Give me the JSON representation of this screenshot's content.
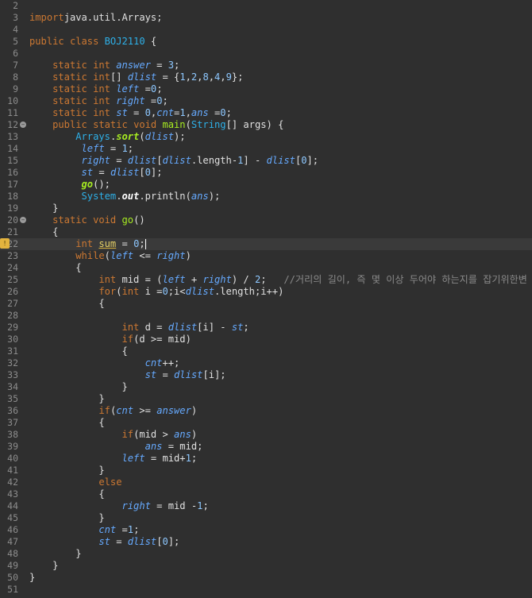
{
  "editor": {
    "language": "java",
    "class_name": "BOJ2110",
    "cursor_line": 22,
    "colors": {
      "background": "#2f2f2f",
      "current_line": "#3a3a3a",
      "keyword": "#cc7832",
      "field": "#66aaff",
      "method": "#a7ec21",
      "class": "#2eb0e8",
      "comment": "#8a8a8a"
    },
    "line_numbers": [
      "2",
      "3",
      "4",
      "5",
      "6",
      "7",
      "8",
      "9",
      "10",
      "11",
      "12",
      "13",
      "14",
      "15",
      "16",
      "17",
      "18",
      "19",
      "20",
      "21",
      "22",
      "23",
      "24",
      "25",
      "26",
      "27",
      "28",
      "29",
      "30",
      "31",
      "32",
      "33",
      "34",
      "35",
      "36",
      "37",
      "38",
      "39",
      "40",
      "41",
      "42",
      "43",
      "44",
      "45",
      "46",
      "47",
      "48",
      "49",
      "50",
      "51"
    ],
    "fold_markers": [
      "12",
      "20"
    ],
    "quick_fix_line": "22",
    "quick_fix_icon": "lightbulb-warning-icon",
    "lines": [
      [],
      [
        [
          "kw",
          "import"
        ],
        [
          "",
          "java.util.Arrays;"
        ]
      ],
      [],
      [
        [
          "kw",
          "public"
        ],
        [
          "",
          " "
        ],
        [
          "kw",
          "class"
        ],
        [
          "",
          " "
        ],
        [
          "cls",
          "BOJ2110"
        ],
        [
          "",
          " {"
        ]
      ],
      [],
      [
        [
          "",
          "    "
        ],
        [
          "kw",
          "static"
        ],
        [
          "",
          " "
        ],
        [
          "kw",
          "int"
        ],
        [
          "",
          " "
        ],
        [
          "fld",
          "answer"
        ],
        [
          "",
          " = "
        ],
        [
          "num",
          "3"
        ],
        [
          "",
          ";"
        ]
      ],
      [
        [
          "",
          "    "
        ],
        [
          "kw",
          "static"
        ],
        [
          "",
          " "
        ],
        [
          "kw",
          "int"
        ],
        [
          "",
          "[] "
        ],
        [
          "fld",
          "dlist"
        ],
        [
          "",
          " = {"
        ],
        [
          "num",
          "1"
        ],
        [
          "",
          ","
        ],
        [
          "num",
          "2"
        ],
        [
          "",
          ","
        ],
        [
          "num",
          "8"
        ],
        [
          "",
          ","
        ],
        [
          "num",
          "4"
        ],
        [
          "",
          ","
        ],
        [
          "num",
          "9"
        ],
        [
          "",
          "};"
        ]
      ],
      [
        [
          "",
          "    "
        ],
        [
          "kw",
          "static"
        ],
        [
          "",
          " "
        ],
        [
          "kw",
          "int"
        ],
        [
          "",
          " "
        ],
        [
          "fld",
          "left"
        ],
        [
          "",
          " ="
        ],
        [
          "num",
          "0"
        ],
        [
          "",
          ";"
        ]
      ],
      [
        [
          "",
          "    "
        ],
        [
          "kw",
          "static"
        ],
        [
          "",
          " "
        ],
        [
          "kw",
          "int"
        ],
        [
          "",
          " "
        ],
        [
          "fld",
          "right"
        ],
        [
          "",
          " ="
        ],
        [
          "num",
          "0"
        ],
        [
          "",
          ";"
        ]
      ],
      [
        [
          "",
          "    "
        ],
        [
          "kw",
          "static"
        ],
        [
          "",
          " "
        ],
        [
          "kw",
          "int"
        ],
        [
          "",
          " "
        ],
        [
          "fld",
          "st"
        ],
        [
          "",
          " = "
        ],
        [
          "num",
          "0"
        ],
        [
          "",
          ","
        ],
        [
          "fld",
          "cnt"
        ],
        [
          "",
          "="
        ],
        [
          "num",
          "1"
        ],
        [
          "",
          ","
        ],
        [
          "fld",
          "ans"
        ],
        [
          "",
          " ="
        ],
        [
          "num",
          "0"
        ],
        [
          "",
          ";"
        ]
      ],
      [
        [
          "",
          "    "
        ],
        [
          "kw",
          "public"
        ],
        [
          "",
          " "
        ],
        [
          "kw",
          "static"
        ],
        [
          "",
          " "
        ],
        [
          "kw",
          "void"
        ],
        [
          "",
          " "
        ],
        [
          "meth",
          "main"
        ],
        [
          "",
          "("
        ],
        [
          "cls",
          "String"
        ],
        [
          "",
          "[] args) {"
        ]
      ],
      [
        [
          "",
          "        "
        ],
        [
          "cls",
          "Arrays"
        ],
        [
          "",
          "."
        ],
        [
          "smeth",
          "sort"
        ],
        [
          "",
          "("
        ],
        [
          "fld",
          "dlist"
        ],
        [
          "",
          ");"
        ]
      ],
      [
        [
          "",
          "         "
        ],
        [
          "fld",
          "left"
        ],
        [
          "",
          " = "
        ],
        [
          "num",
          "1"
        ],
        [
          "",
          ";"
        ]
      ],
      [
        [
          "",
          "         "
        ],
        [
          "fld",
          "right"
        ],
        [
          "",
          " = "
        ],
        [
          "fld",
          "dlist"
        ],
        [
          "",
          "["
        ],
        [
          "fld",
          "dlist"
        ],
        [
          "",
          ".length-"
        ],
        [
          "num",
          "1"
        ],
        [
          "",
          "] - "
        ],
        [
          "fld",
          "dlist"
        ],
        [
          "",
          "["
        ],
        [
          "num",
          "0"
        ],
        [
          "",
          "];"
        ]
      ],
      [
        [
          "",
          "         "
        ],
        [
          "fld",
          "st"
        ],
        [
          "",
          " = "
        ],
        [
          "fld",
          "dlist"
        ],
        [
          "",
          "["
        ],
        [
          "num",
          "0"
        ],
        [
          "",
          "];"
        ]
      ],
      [
        [
          "",
          "         "
        ],
        [
          "smeth",
          "go"
        ],
        [
          "",
          "();"
        ]
      ],
      [
        [
          "",
          "         "
        ],
        [
          "cls",
          "System"
        ],
        [
          "",
          "."
        ],
        [
          "sfld",
          "out"
        ],
        [
          "",
          ".println("
        ],
        [
          "fld",
          "ans"
        ],
        [
          "",
          ");"
        ]
      ],
      [
        [
          "",
          "    }"
        ]
      ],
      [
        [
          "",
          "    "
        ],
        [
          "kw",
          "static"
        ],
        [
          "",
          " "
        ],
        [
          "kw",
          "void"
        ],
        [
          "",
          " "
        ],
        [
          "meth",
          "go"
        ],
        [
          "",
          "()"
        ]
      ],
      [
        [
          "",
          "    {"
        ]
      ],
      [
        [
          "",
          "        "
        ],
        [
          "kw",
          "int"
        ],
        [
          "",
          " "
        ],
        [
          "warn",
          "sum"
        ],
        [
          "",
          " = "
        ],
        [
          "num",
          "0"
        ],
        [
          "",
          ";"
        ],
        [
          "caret",
          ""
        ]
      ],
      [
        [
          "",
          "        "
        ],
        [
          "kw",
          "while"
        ],
        [
          "",
          "("
        ],
        [
          "fld",
          "left"
        ],
        [
          "",
          " <= "
        ],
        [
          "fld",
          "right"
        ],
        [
          "",
          ")"
        ]
      ],
      [
        [
          "",
          "        {"
        ]
      ],
      [
        [
          "",
          "            "
        ],
        [
          "kw",
          "int"
        ],
        [
          "",
          " mid = ("
        ],
        [
          "fld",
          "left"
        ],
        [
          "",
          " + "
        ],
        [
          "fld",
          "right"
        ],
        [
          "",
          ") / "
        ],
        [
          "num",
          "2"
        ],
        [
          "",
          ";   "
        ],
        [
          "cmt",
          "//거리의 길이, 즉 몇 이상 두어야 하는지를 잡기위한변"
        ]
      ],
      [
        [
          "",
          "            "
        ],
        [
          "kw",
          "for"
        ],
        [
          "",
          "("
        ],
        [
          "kw",
          "int"
        ],
        [
          "",
          " i ="
        ],
        [
          "num",
          "0"
        ],
        [
          "",
          ";i<"
        ],
        [
          "fld",
          "dlist"
        ],
        [
          "",
          ".length;i++)"
        ]
      ],
      [
        [
          "",
          "            {"
        ]
      ],
      [],
      [
        [
          "",
          "                "
        ],
        [
          "kw",
          "int"
        ],
        [
          "",
          " d = "
        ],
        [
          "fld",
          "dlist"
        ],
        [
          "",
          "[i] - "
        ],
        [
          "fld",
          "st"
        ],
        [
          "",
          ";"
        ]
      ],
      [
        [
          "",
          "                "
        ],
        [
          "kw",
          "if"
        ],
        [
          "",
          "(d >= mid)"
        ]
      ],
      [
        [
          "",
          "                {"
        ]
      ],
      [
        [
          "",
          "                    "
        ],
        [
          "fld",
          "cnt"
        ],
        [
          "",
          "++;"
        ]
      ],
      [
        [
          "",
          "                    "
        ],
        [
          "fld",
          "st"
        ],
        [
          "",
          " = "
        ],
        [
          "fld",
          "dlist"
        ],
        [
          "",
          "[i];"
        ]
      ],
      [
        [
          "",
          "                }"
        ]
      ],
      [
        [
          "",
          "            }"
        ]
      ],
      [
        [
          "",
          "            "
        ],
        [
          "kw",
          "if"
        ],
        [
          "",
          "("
        ],
        [
          "fld",
          "cnt"
        ],
        [
          "",
          " >= "
        ],
        [
          "fld",
          "answer"
        ],
        [
          "",
          ")"
        ]
      ],
      [
        [
          "",
          "            {"
        ]
      ],
      [
        [
          "",
          "                "
        ],
        [
          "kw",
          "if"
        ],
        [
          "",
          "(mid > "
        ],
        [
          "fld",
          "ans"
        ],
        [
          "",
          ")"
        ]
      ],
      [
        [
          "",
          "                    "
        ],
        [
          "fld",
          "ans"
        ],
        [
          "",
          " = mid;"
        ]
      ],
      [
        [
          "",
          "                "
        ],
        [
          "fld",
          "left"
        ],
        [
          "",
          " = mid+"
        ],
        [
          "num",
          "1"
        ],
        [
          "",
          ";"
        ]
      ],
      [
        [
          "",
          "            }"
        ]
      ],
      [
        [
          "",
          "            "
        ],
        [
          "kw",
          "else"
        ]
      ],
      [
        [
          "",
          "            {"
        ]
      ],
      [
        [
          "",
          "                "
        ],
        [
          "fld",
          "right"
        ],
        [
          "",
          " = mid -"
        ],
        [
          "num",
          "1"
        ],
        [
          "",
          ";"
        ]
      ],
      [
        [
          "",
          "            }"
        ]
      ],
      [
        [
          "",
          "            "
        ],
        [
          "fld",
          "cnt"
        ],
        [
          "",
          " ="
        ],
        [
          "num",
          "1"
        ],
        [
          "",
          ";"
        ]
      ],
      [
        [
          "",
          "            "
        ],
        [
          "fld",
          "st"
        ],
        [
          "",
          " = "
        ],
        [
          "fld",
          "dlist"
        ],
        [
          "",
          "["
        ],
        [
          "num",
          "0"
        ],
        [
          "",
          "];"
        ]
      ],
      [
        [
          "",
          "        }"
        ]
      ],
      [
        [
          "",
          "    }"
        ]
      ],
      [
        [
          "",
          "}"
        ]
      ],
      []
    ]
  }
}
